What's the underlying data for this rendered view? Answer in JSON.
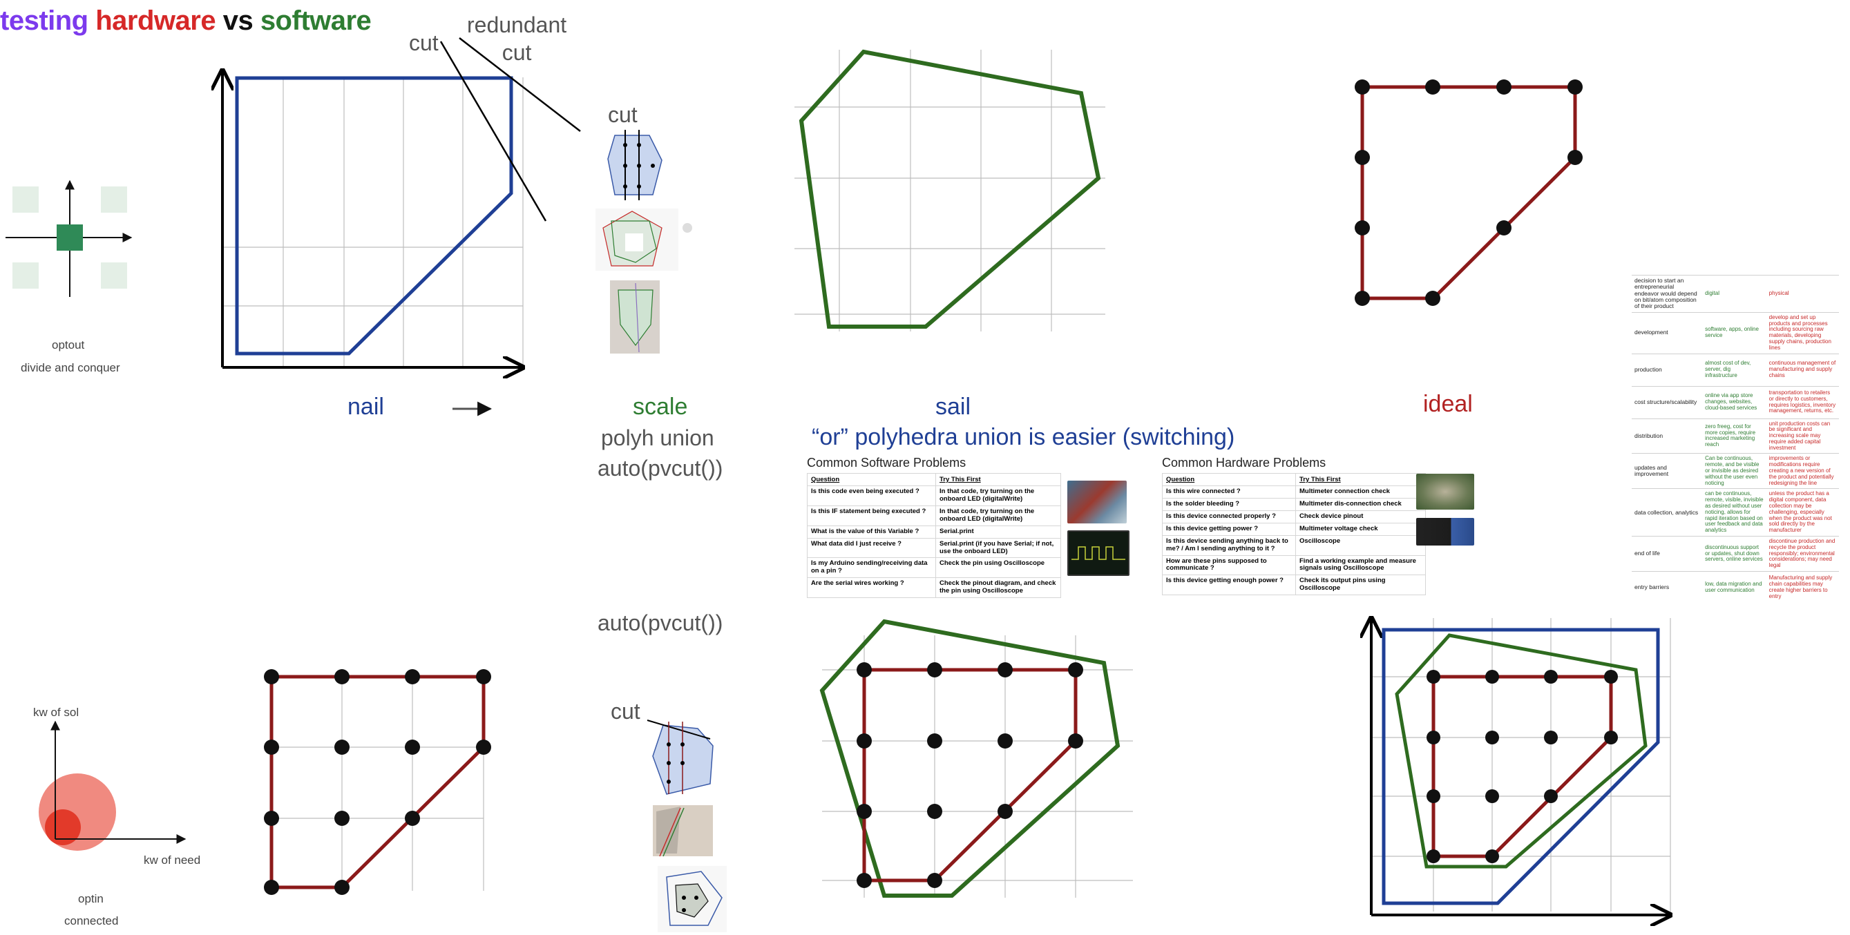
{
  "title": {
    "part1": "testing ",
    "part2": "hardware",
    "part3": " vs ",
    "part4": "software",
    "colors": {
      "testing": "#7c3aed",
      "hardware": "#d62828",
      "vs": "#111111",
      "software": "#2e7d32"
    }
  },
  "labels": {
    "optout": "optout",
    "divide": "divide and conquer",
    "cut_top": "cut",
    "redundant_cut": "redundant\ncut",
    "cut_scale": "cut",
    "cut_bottom": "cut",
    "nail": "nail",
    "scale": "scale",
    "polyh_union": "polyh union",
    "auto_pvcut_1": "auto(pvcut())",
    "auto_pvcut_2": "auto(pvcut())",
    "sail": "sail",
    "ideal": "ideal",
    "or_union": "“or” polyhedra union is easier (switching)",
    "kw_sol": "kw of sol",
    "kw_need": "kw of need",
    "optin": "optin",
    "connected": "connected",
    "arrow_glyph": "→"
  },
  "software_table": {
    "title": "Common Software Problems",
    "headers": [
      "Question",
      "Try This First"
    ],
    "rows": [
      [
        "Is this code even being executed ?",
        "In that code, try turning on the onboard LED (digitalWrite)"
      ],
      [
        "Is this IF statement being executed ?",
        "In that code, try turning on the onboard LED (digitalWrite)"
      ],
      [
        "What is the value of this Variable ?",
        "Serial.print"
      ],
      [
        "What data did I just receive ?",
        "Serial.print (if you have Serial; if not, use the onboard LED)"
      ],
      [
        "Is my Arduino sending/receiving data on a pin ?",
        "Check the pin using Oscilloscope"
      ],
      [
        "Are the serial wires working ?",
        "Check the pinout diagram, and check the pin using Oscilloscope"
      ]
    ]
  },
  "hardware_table": {
    "title": "Common Hardware Problems",
    "headers": [
      "Question",
      "Try This First"
    ],
    "rows": [
      [
        "Is this wire connected ?",
        "Multimeter connection check"
      ],
      [
        "Is the solder bleeding ?",
        "Multimeter dis-connection check"
      ],
      [
        "Is this device connected properly ?",
        "Check device pinout"
      ],
      [
        "Is this device getting power ?",
        "Multimeter voltage check"
      ],
      [
        "Is this device sending anything back to me? / Am I sending anything to it ?",
        "Oscilloscope"
      ],
      [
        "How are these pins supposed to communicate ?",
        "Find a working example and measure signals using Oscilloscope"
      ],
      [
        "Is this device getting enough power ?",
        "Check its output pins using Oscilloscope"
      ]
    ]
  },
  "comparison_table": {
    "header": [
      "decision to start an entrepreneurial endeavor would depend on bit/atom composition of their product",
      "digital",
      "physical"
    ],
    "rows": [
      [
        "development",
        "software, apps, online service",
        "develop and set up products and processes including sourcing raw materials, developing supply chains, production lines"
      ],
      [
        "production",
        "almost cost of dev, server, dig infrastructure",
        "continuous management of manufacturing and supply chains"
      ],
      [
        "cost structure/scalability",
        "online via app store changes, websites, cloud-based services",
        "transportation to retailers or directly to customers, requires logistics, inventory management, returns, etc."
      ],
      [
        "distribution",
        "zero freeg, cost for more copies, require increased marketing reach",
        "unit production costs can be significant and increasing scale may require added capital investment"
      ],
      [
        "updates and improvement",
        "Can be continuous, remote, and be visible or invisible as desired without the user even noticing",
        "improvements or modifications require creating a new version of the product and potentially redesigning the line"
      ],
      [
        "data collection, analytics",
        "can be continuous, remote, visible, invisible as desired without user noticing, allows for rapid iteration based on user feedback and data analytics",
        "unless the product has a digital component, data collection may be challenging, especially when the product was not sold directly by the manufacturer"
      ],
      [
        "end of life",
        "discontinuous support or updates, shut down servers, online services",
        "discontinue production and recycle the product responsibly; environmental considerations; may need legal"
      ],
      [
        "entry barriers",
        "low, data migration and user communication",
        "Manufacturing and supply chain capabilities may create higher barriers to entry"
      ]
    ]
  }
}
